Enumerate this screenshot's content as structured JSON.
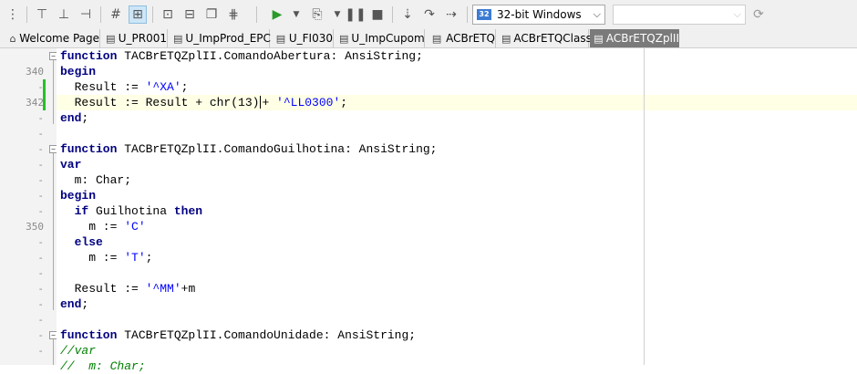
{
  "toolbar": {
    "platform_value": "32-bit Windows",
    "config_value": ""
  },
  "tabs": [
    {
      "label": "Welcome Page",
      "icon": "home-icon",
      "active": false
    },
    {
      "label": "U_PR001",
      "icon": "unit-file-icon",
      "active": false
    },
    {
      "label": "U_ImpProd_EPC",
      "icon": "unit-file-icon",
      "active": false
    },
    {
      "label": "U_FI030",
      "icon": "unit-file-icon",
      "active": false
    },
    {
      "label": "U_ImpCupom",
      "icon": "unit-file-icon",
      "active": false
    },
    {
      "label": "ACBrETQ",
      "icon": "unit-file-icon",
      "active": false
    },
    {
      "label": "ACBrETQClass",
      "icon": "unit-file-icon",
      "active": false
    },
    {
      "label": "ACBrETQZplII",
      "icon": "unit-file-icon",
      "active": true
    }
  ],
  "gutter": {
    "line_340": "340",
    "line_342": "342",
    "line_350": "350",
    "dot": "-"
  },
  "code": {
    "l1_kw": "function",
    "l1_rest": " TACBrETQZplII.ComandoAbertura: AnsiString;",
    "l2_kw": "begin",
    "l3_pre": "  Result := ",
    "l3_str": "'^XA'",
    "l3_post": ";",
    "l4_pre": "  Result := Result + chr(13)",
    "l4_mid": "+ ",
    "l4_str": "'^LL0300'",
    "l4_post": ";",
    "l5_kw": "end",
    "l5_post": ";",
    "l7_kw": "function",
    "l7_rest": " TACBrETQZplII.ComandoGuilhotina: AnsiString;",
    "l8_kw": "var",
    "l9_text": "  m: Char;",
    "l10_kw": "begin",
    "l11_kw1": "if",
    "l11_mid": " Guilhotina ",
    "l11_kw2": "then",
    "l12_pre": "    m := ",
    "l12_str": "'C'",
    "l13_kw": "else",
    "l14_pre": "    m := ",
    "l14_str": "'T'",
    "l14_post": ";",
    "l16_pre": "  Result := ",
    "l16_str": "'^MM'",
    "l16_post": "+m",
    "l17_kw": "end",
    "l17_post": ";",
    "l19_kw": "function",
    "l19_rest": " TACBrETQZplII.ComandoUnidade: AnsiString;",
    "l20_cmt": "//var",
    "l21_cmt": "//  m: Char;"
  },
  "colors": {
    "keyword": "#000080",
    "string": "#0000ff",
    "comment": "#008000",
    "modified_marker": "#22c322",
    "current_line": "#ffffe6"
  }
}
